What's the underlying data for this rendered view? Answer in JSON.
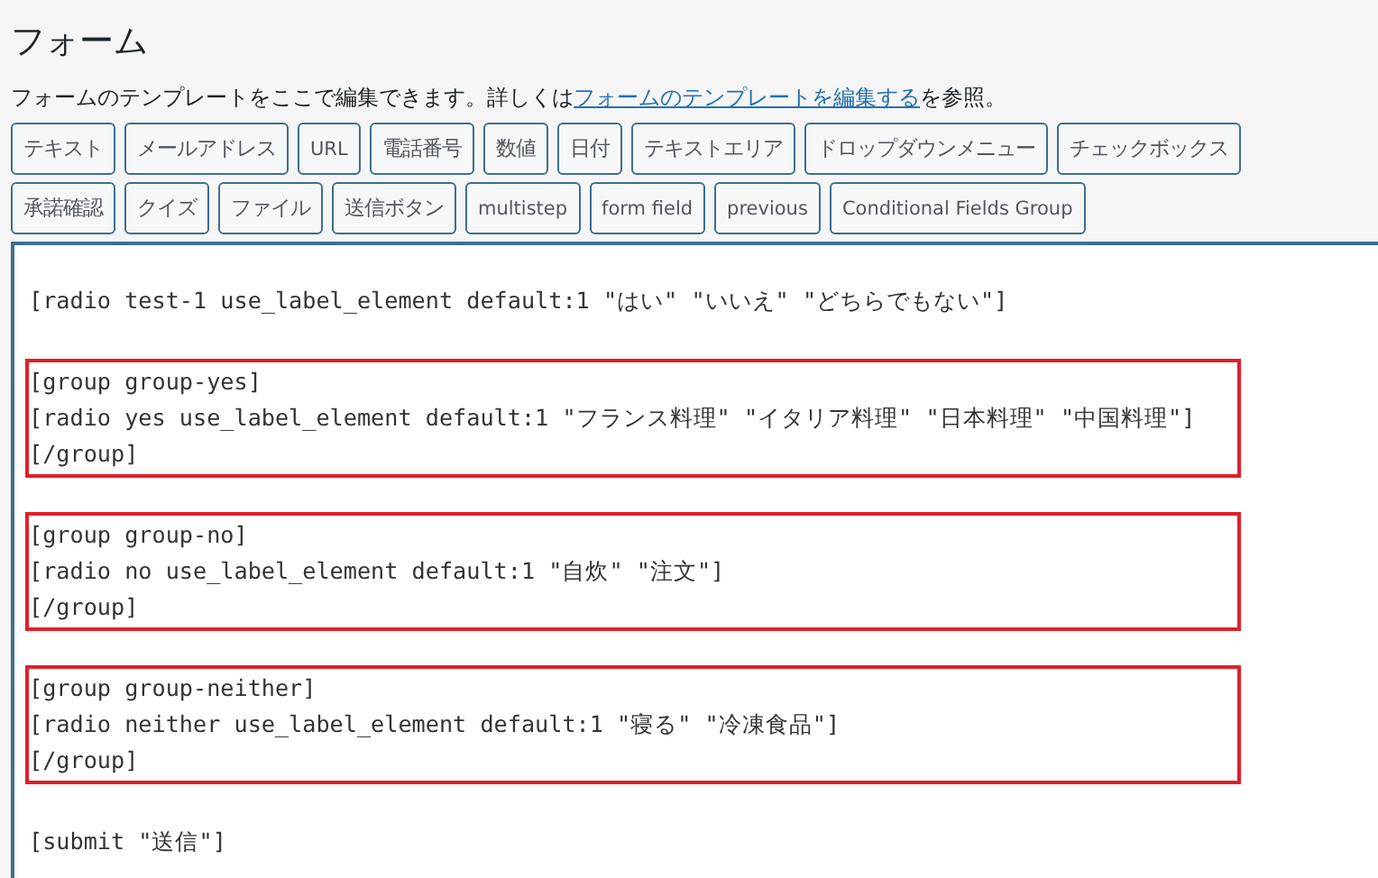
{
  "title": "フォーム",
  "description": {
    "text": "フォームのテンプレートをここで編集できます。詳しくは",
    "link": "フォームのテンプレートを編集する",
    "suffix": "を参照。"
  },
  "tag_buttons": [
    [
      "テキスト",
      "メールアドレス",
      "URL",
      "電話番号",
      "数値",
      "日付",
      "テキストエリア",
      "ドロップダウンメニュー",
      "チェックボックス"
    ],
    [
      "承諾確認",
      "クイズ",
      "ファイル",
      "送信ボタン",
      "multistep",
      "form field",
      "previous",
      "Conditional Fields Group"
    ]
  ],
  "editor": {
    "blocks": [
      {
        "highlighted": false,
        "lines": [
          "[radio test-1 use_label_element default:1 \"はい\" \"いいえ\" \"どちらでもない\"]"
        ]
      },
      {
        "highlighted": true,
        "lines": [
          "[group group-yes]",
          "[radio yes use_label_element default:1 \"フランス料理\" \"イタリア料理\" \"日本料理\" \"中国料理\"]",
          "[/group]"
        ]
      },
      {
        "highlighted": true,
        "lines": [
          "[group group-no]",
          "[radio no use_label_element default:1 \"自炊\" \"注文\"]",
          "[/group]"
        ]
      },
      {
        "highlighted": true,
        "lines": [
          "[group group-neither]",
          "[radio neither use_label_element default:1 \"寝る\" \"冷凍食品\"]",
          "[/group]"
        ]
      },
      {
        "highlighted": false,
        "lines": [
          "[submit \"送信\"]"
        ]
      }
    ]
  }
}
